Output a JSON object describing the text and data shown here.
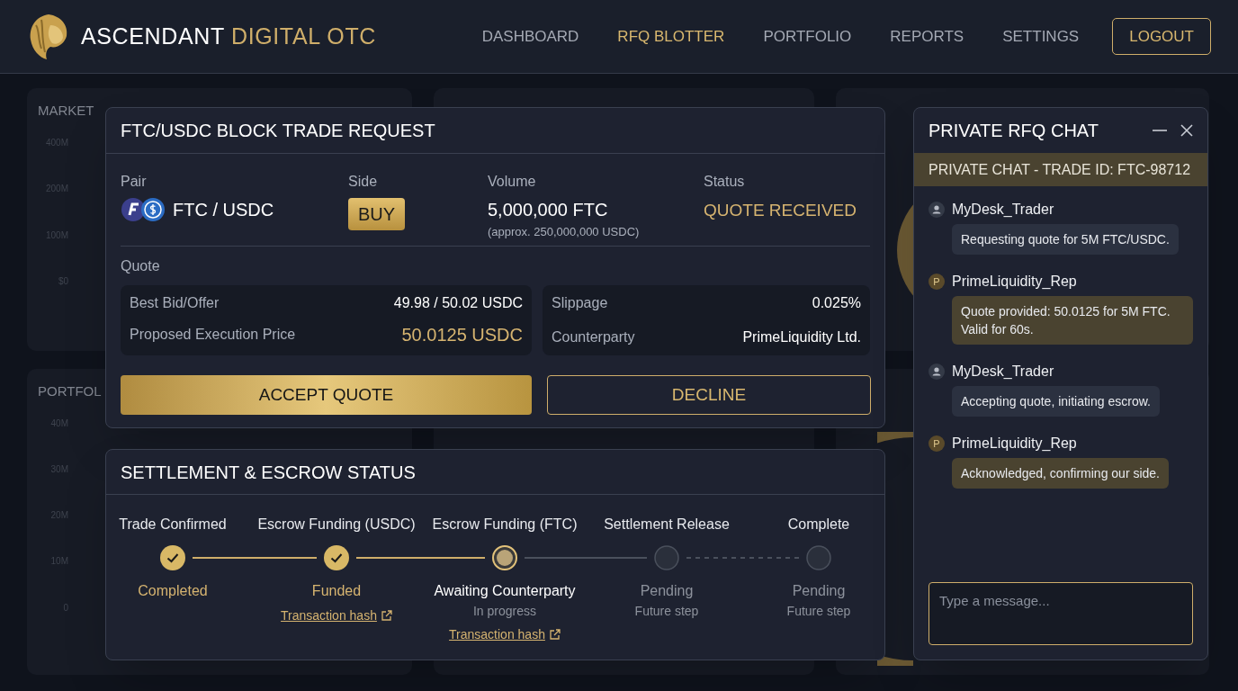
{
  "header": {
    "brand": "ASCENDANT",
    "brand_accent": "DIGITAL OTC",
    "nav": [
      {
        "label": "DASHBOARD",
        "selected": false
      },
      {
        "label": "RFQ BLOTTER",
        "selected": true
      },
      {
        "label": "PORTFOLIO",
        "selected": false
      },
      {
        "label": "REPORTS",
        "selected": false
      },
      {
        "label": "SETTINGS",
        "selected": false
      }
    ],
    "logout": "LOGOUT"
  },
  "background_cards": [
    {
      "title": "MARKET",
      "axis_labels": [
        "400M",
        "200M",
        "100M",
        "$0"
      ]
    },
    {
      "title": "PORTFOL",
      "axis_labels": [
        "40M",
        "30M",
        "20M",
        "10M",
        "0"
      ]
    }
  ],
  "trade_request": {
    "title": "FTC/USDC BLOCK TRADE REQUEST",
    "pair_label": "Pair",
    "pair": "FTC / USDC",
    "side_label": "Side",
    "side": "BUY",
    "volume_label": "Volume",
    "volume": "5,000,000 FTC",
    "volume_note": "(approx. 250,000,000 USDC)",
    "status_label": "Status",
    "status": "QUOTE RECEIVED",
    "quote_label": "Quote",
    "quote_left": [
      {
        "label": "Best Bid/Offer",
        "value": "49.98 / 50.02 USDC",
        "kind": "plain"
      },
      {
        "label": "Proposed Execution Price",
        "value": "50.0125 USDC",
        "kind": "highlight"
      }
    ],
    "quote_right": [
      {
        "label": "Slippage",
        "value": "0.025%"
      },
      {
        "label": "Counterparty",
        "value": "PrimeLiquidity Ltd."
      }
    ],
    "accept": "ACCEPT QUOTE",
    "decline": "DECLINE"
  },
  "settlement": {
    "title": "SETTLEMENT & ESCROW STATUS",
    "steps": [
      {
        "label": "Trade Confirmed",
        "kind": "done",
        "status": "Completed"
      },
      {
        "label": "Escrow Funding (USDC)",
        "kind": "done",
        "status": "Funded",
        "link": "Transaction hash"
      },
      {
        "label": "Escrow Funding (FTC)",
        "kind": "active",
        "status": "Awaiting Counterparty",
        "note": "In progress",
        "link": "Transaction hash"
      },
      {
        "label": "Settlement Release",
        "kind": "pending",
        "status": "Pending",
        "note": "Future step"
      },
      {
        "label": "Complete",
        "kind": "pending",
        "status": "Pending",
        "note": "Future step"
      }
    ]
  },
  "chat": {
    "title": "PRIVATE RFQ CHAT",
    "banner": "PRIVATE CHAT - TRADE ID: FTC-98712",
    "messages": [
      {
        "kind": "me",
        "sender": "MyDesk_Trader",
        "text": "Requesting quote for 5M FTC/USDC."
      },
      {
        "kind": "counterparty",
        "avatar_letter": "P",
        "sender": "PrimeLiquidity_Rep",
        "text": "Quote provided: 50.0125 for 5M FTC. Valid for 60s."
      },
      {
        "kind": "me",
        "sender": "MyDesk_Trader",
        "text": "Accepting quote, initiating escrow."
      },
      {
        "kind": "counterparty",
        "avatar_letter": "P",
        "sender": "PrimeLiquidity_Rep",
        "text": "Acknowledged, confirming our side."
      }
    ],
    "placeholder": "Type a message..."
  }
}
